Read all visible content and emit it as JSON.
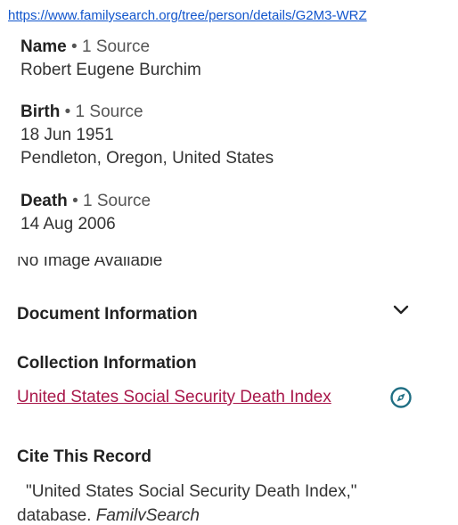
{
  "url": "https://www.familysearch.org/tree/person/details/G2M3-WRZ",
  "name": {
    "label": "Name",
    "source": "1 Source",
    "value": "Robert Eugene Burchim"
  },
  "birth": {
    "label": "Birth",
    "source": "1 Source",
    "date": "18 Jun 1951",
    "place": "Pendleton, Oregon, United States"
  },
  "death": {
    "label": "Death",
    "source": "1 Source",
    "date": "14 Aug 2006"
  },
  "image_note": "No Image Available",
  "document_information": "Document Information",
  "collection_information": "Collection Information",
  "collection_link": "United States Social Security Death Index",
  "cite_heading": "Cite This Record",
  "cite_line1": "\"United States Social Security Death Index,\"",
  "cite_line2_a": "database, ",
  "cite_line2_b": "FamilySearch",
  "colors": {
    "link": "#1155cc",
    "collection_link": "#a8174a",
    "icon": "#1f6e83"
  },
  "icons": {
    "chevron": "chevron-down-icon",
    "compass": "compass-icon"
  }
}
